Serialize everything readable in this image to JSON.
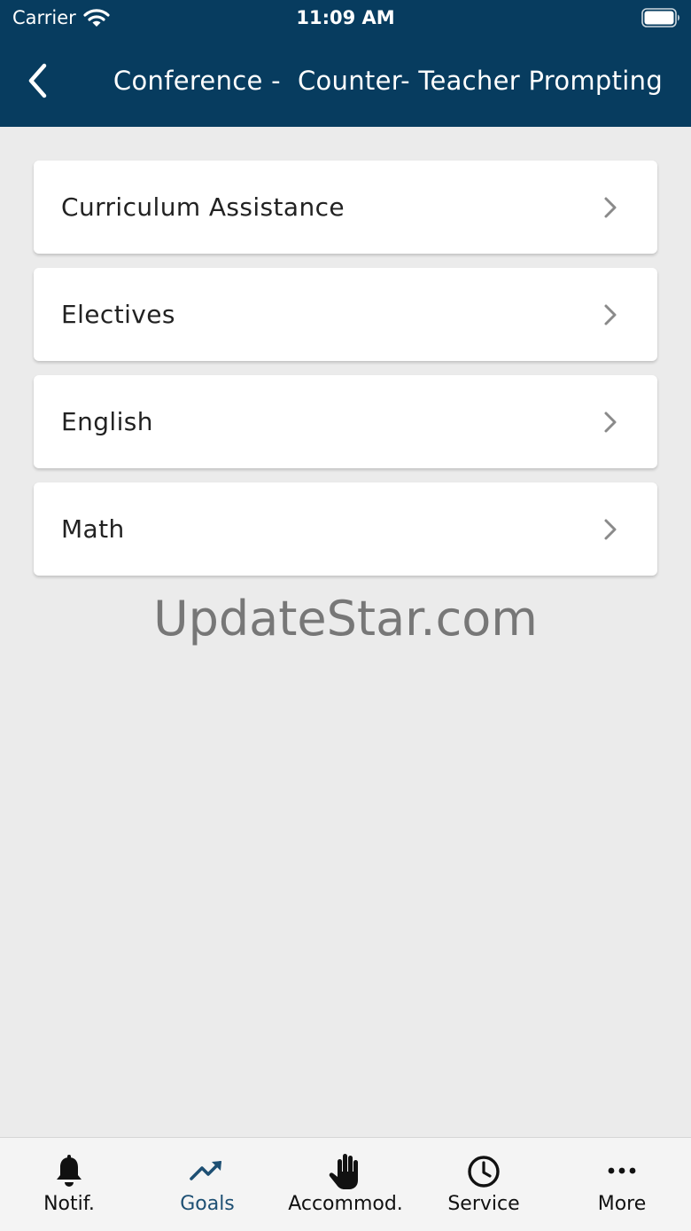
{
  "status_bar": {
    "carrier": "Carrier",
    "time": "11:09 AM"
  },
  "nav": {
    "title": "Conference -  Counter- Teacher Prompting"
  },
  "list": {
    "items": [
      {
        "label": "Curriculum Assistance"
      },
      {
        "label": "Electives"
      },
      {
        "label": "English"
      },
      {
        "label": "Math"
      }
    ]
  },
  "watermark": "UpdateStar.com",
  "tabs": [
    {
      "label": "Notif.",
      "icon": "bell-icon"
    },
    {
      "label": "Goals",
      "icon": "trending-up-icon",
      "active": true
    },
    {
      "label": "Accommod.",
      "icon": "hand-icon"
    },
    {
      "label": "Service",
      "icon": "clock-icon"
    },
    {
      "label": "More",
      "icon": "more-dots-icon"
    }
  ],
  "colors": {
    "header_bg": "#073c5f",
    "page_bg": "#ebebeb",
    "active_tab": "#1d4f73"
  }
}
